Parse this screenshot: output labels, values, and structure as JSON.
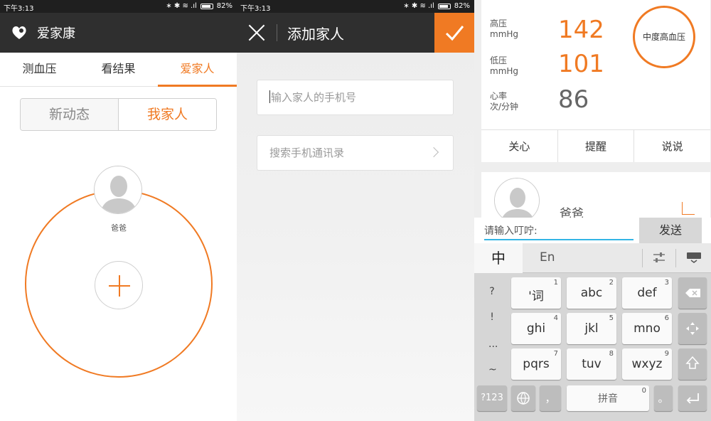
{
  "status": {
    "time": "下午3:13",
    "icons": "∗ ✱ ≋ .ıl",
    "battery": "82%"
  },
  "panel1": {
    "app_title": "爱家康",
    "tabs": [
      "测血压",
      "看结果",
      "爱家人"
    ],
    "active_tab": 2,
    "segment": {
      "left": "新动态",
      "right": "我家人"
    },
    "member_name": "爸爸"
  },
  "panel2": {
    "title": "添加家人",
    "phone_placeholder": "输入家人的手机号",
    "contacts_label": "搜索手机通讯录"
  },
  "panel3": {
    "metrics": [
      {
        "label1": "高压",
        "label2": "mmHg",
        "value": "142"
      },
      {
        "label1": "低压",
        "label2": "mmHg",
        "value": "101"
      },
      {
        "label1": "心率",
        "label2": "次/分钟",
        "value": "86"
      }
    ],
    "status_badge": "中度高血压",
    "actions": [
      "关心",
      "提醒",
      "说说"
    ],
    "family_name": "爸爸",
    "input_placeholder": "请输入叮咛:",
    "send_label": "发送",
    "kb_zh": "中",
    "kb_en": "En",
    "side_keys": [
      "?",
      "!",
      "...",
      "~"
    ],
    "keys": [
      {
        "label": "'词",
        "num": "1"
      },
      {
        "label": "abc",
        "num": "2"
      },
      {
        "label": "def",
        "num": "3"
      },
      {
        "label": "ghi",
        "num": "4"
      },
      {
        "label": "jkl",
        "num": "5"
      },
      {
        "label": "mno",
        "num": "6"
      },
      {
        "label": "pqrs",
        "num": "7"
      },
      {
        "label": "tuv",
        "num": "8"
      },
      {
        "label": "wxyz",
        "num": "9"
      }
    ],
    "bottom": {
      "num_label": "?123",
      "comma": "，",
      "space": "拼音",
      "space_num": "0",
      "period": "。"
    }
  },
  "colors": {
    "accent": "#f07a23",
    "titlebar": "#2f2f2f",
    "focus_line": "#33b5e5"
  }
}
